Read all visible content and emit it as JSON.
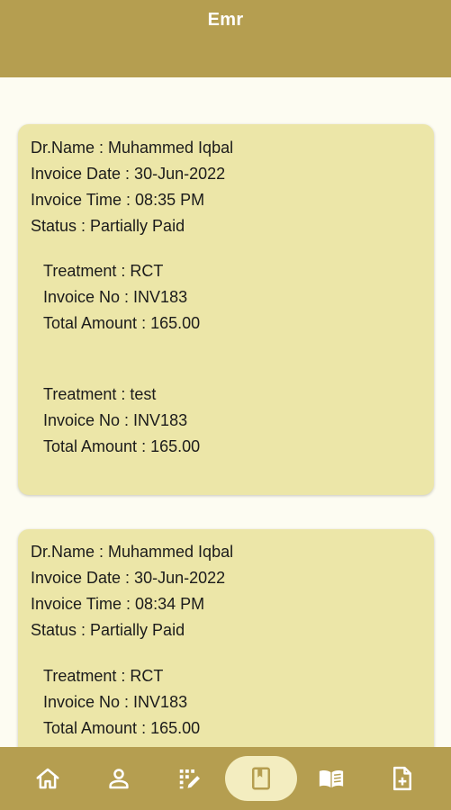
{
  "app": {
    "title": "Emr"
  },
  "invoices": [
    {
      "doctor": "Dr.Name : Muhammed Iqbal",
      "date": "Invoice Date : 30-Jun-2022",
      "time": "Invoice Time : 08:35 PM",
      "status": "Status : Partially Paid",
      "items": [
        {
          "treatment": "Treatment : RCT",
          "invoice_no": "Invoice No : INV183",
          "total": "Total Amount : 165.00"
        },
        {
          "treatment": "Treatment : test",
          "invoice_no": "Invoice No : INV183",
          "total": "Total Amount : 165.00"
        }
      ]
    },
    {
      "doctor": "Dr.Name : Muhammed Iqbal",
      "date": "Invoice Date : 30-Jun-2022",
      "time": "Invoice Time : 08:34 PM",
      "status": "Status : Partially Paid",
      "items": [
        {
          "treatment": "Treatment : RCT",
          "invoice_no": "Invoice No : INV183",
          "total": "Total Amount : 165.00"
        }
      ]
    }
  ],
  "bottom_nav": [
    {
      "icon": "home-icon",
      "active": false
    },
    {
      "icon": "person-icon",
      "active": false
    },
    {
      "icon": "edit-note-icon",
      "active": false
    },
    {
      "icon": "bookmark-book-icon",
      "active": true
    },
    {
      "icon": "open-book-icon",
      "active": false
    },
    {
      "icon": "add-document-icon",
      "active": false
    }
  ],
  "colors": {
    "primary": "#b59e50",
    "background": "#fdfcf2",
    "card": "#ece6a8",
    "active_nav": "#f3edc0"
  }
}
